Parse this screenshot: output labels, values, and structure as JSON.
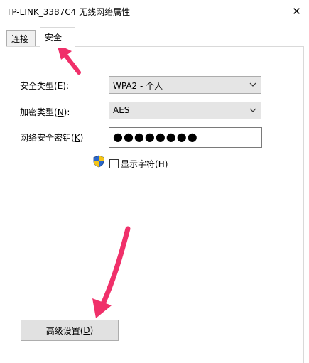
{
  "window": {
    "title": "TP-LINK_3387C4 无线网络属性",
    "close_glyph": "✕"
  },
  "tabs": [
    {
      "label": "连接",
      "active": false
    },
    {
      "label": "安全",
      "active": true
    }
  ],
  "security": {
    "type_label": "安全类型(",
    "type_key": "E",
    "type_label_end": "):",
    "type_value": "WPA2 - 个人",
    "encryption_label": "加密类型(",
    "encryption_key": "N",
    "encryption_label_end": "):",
    "encryption_value": "AES",
    "key_label": "网络安全密钥(",
    "key_key": "K",
    "key_label_end": ")",
    "key_value": "●●●●●●●●",
    "show_chars_label": "显示字符(",
    "show_chars_key": "H",
    "show_chars_label_end": ")",
    "show_chars_checked": false
  },
  "advanced_button": {
    "label": "高级设置(",
    "key": "D",
    "label_end": ")"
  },
  "icons": {
    "close": "close-icon",
    "dropdown": "chevron-down-icon",
    "shield": "uac-shield-icon"
  },
  "colors": {
    "annotation_arrow": "#f0306a",
    "button_bg": "#e1e1e1",
    "select_bg": "#e5e5e5"
  }
}
